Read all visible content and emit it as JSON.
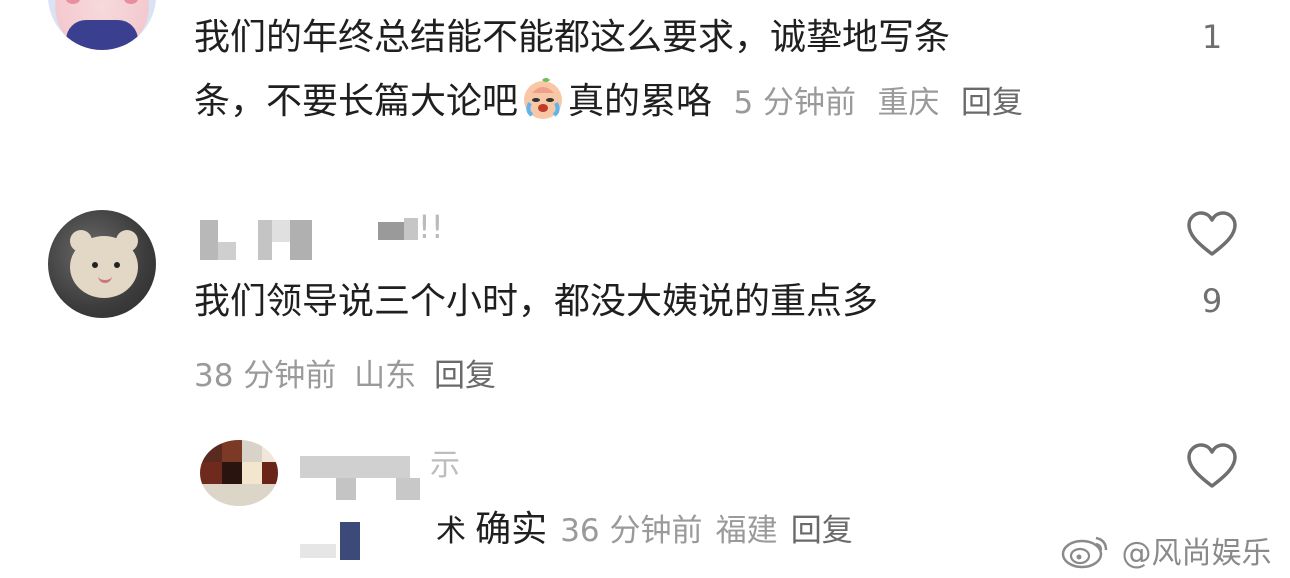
{
  "comments": [
    {
      "text_line1": "我们的年终总结能不能都这么要求，诚挚地写条",
      "text_line2_pre": "条，不要长篇大论吧",
      "emoji": "crying-face-emoji",
      "text_line2_post": "真的累咯",
      "time": "5 分钟前",
      "location": "重庆",
      "reply_label": "回复",
      "like_count": "1"
    },
    {
      "username_suffix": "!!",
      "text": "我们领导说三个小时，都没大姨说的重点多",
      "time": "38 分钟前",
      "location": "山东",
      "reply_label": "回复",
      "like_count": "9"
    },
    {
      "username_suffix": "示",
      "text": "确实",
      "text_prefix_fragment": "术",
      "time": "36 分钟前",
      "location": "福建",
      "reply_label": "回复"
    }
  ],
  "watermark": {
    "text": "@风尚娱乐",
    "icon": "weibo-logo-icon"
  },
  "colors": {
    "text_main": "#1f1f1f",
    "text_meta": "#9a9a9a",
    "icon_heart": "#6f6f6f"
  }
}
